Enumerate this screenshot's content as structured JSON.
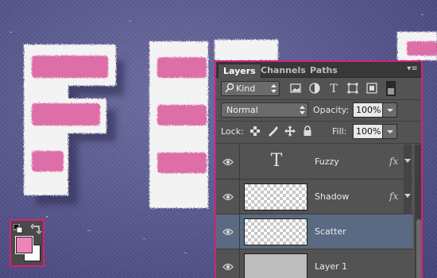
{
  "artwork": {
    "fur_white": "#f3f3f3",
    "fur_pink": "#dd6ea7",
    "background": "#5b5a8e"
  },
  "tools": {
    "foreground_color": "#ef84b8",
    "background_color": "#ffffff",
    "highlight_color": "#d81f78"
  },
  "panel": {
    "tabs": [
      {
        "label": "Layers",
        "active": true
      },
      {
        "label": "Channels",
        "active": false
      },
      {
        "label": "Paths",
        "active": false
      }
    ],
    "filter": {
      "kind_label": "Kind",
      "icons": [
        "pixel-filter-icon",
        "adjustment-filter-icon",
        "type-filter-icon",
        "shape-filter-icon",
        "smart-object-filter-icon"
      ]
    },
    "blend_mode": "Normal",
    "opacity_label": "Opacity:",
    "opacity_value": "100%",
    "lock_label": "Lock:",
    "fill_label": "Fill:",
    "fill_value": "100%",
    "layers": [
      {
        "name": "Fuzzy",
        "kind": "text",
        "thumb_glyph": "T",
        "fx": "fx",
        "selected": false
      },
      {
        "name": "Shadow",
        "kind": "pixel",
        "fx": "fx",
        "selected": false
      },
      {
        "name": "Scatter",
        "kind": "pixel",
        "selected": true
      },
      {
        "name": "Layer 1",
        "kind": "pixel",
        "selected": false
      }
    ]
  }
}
